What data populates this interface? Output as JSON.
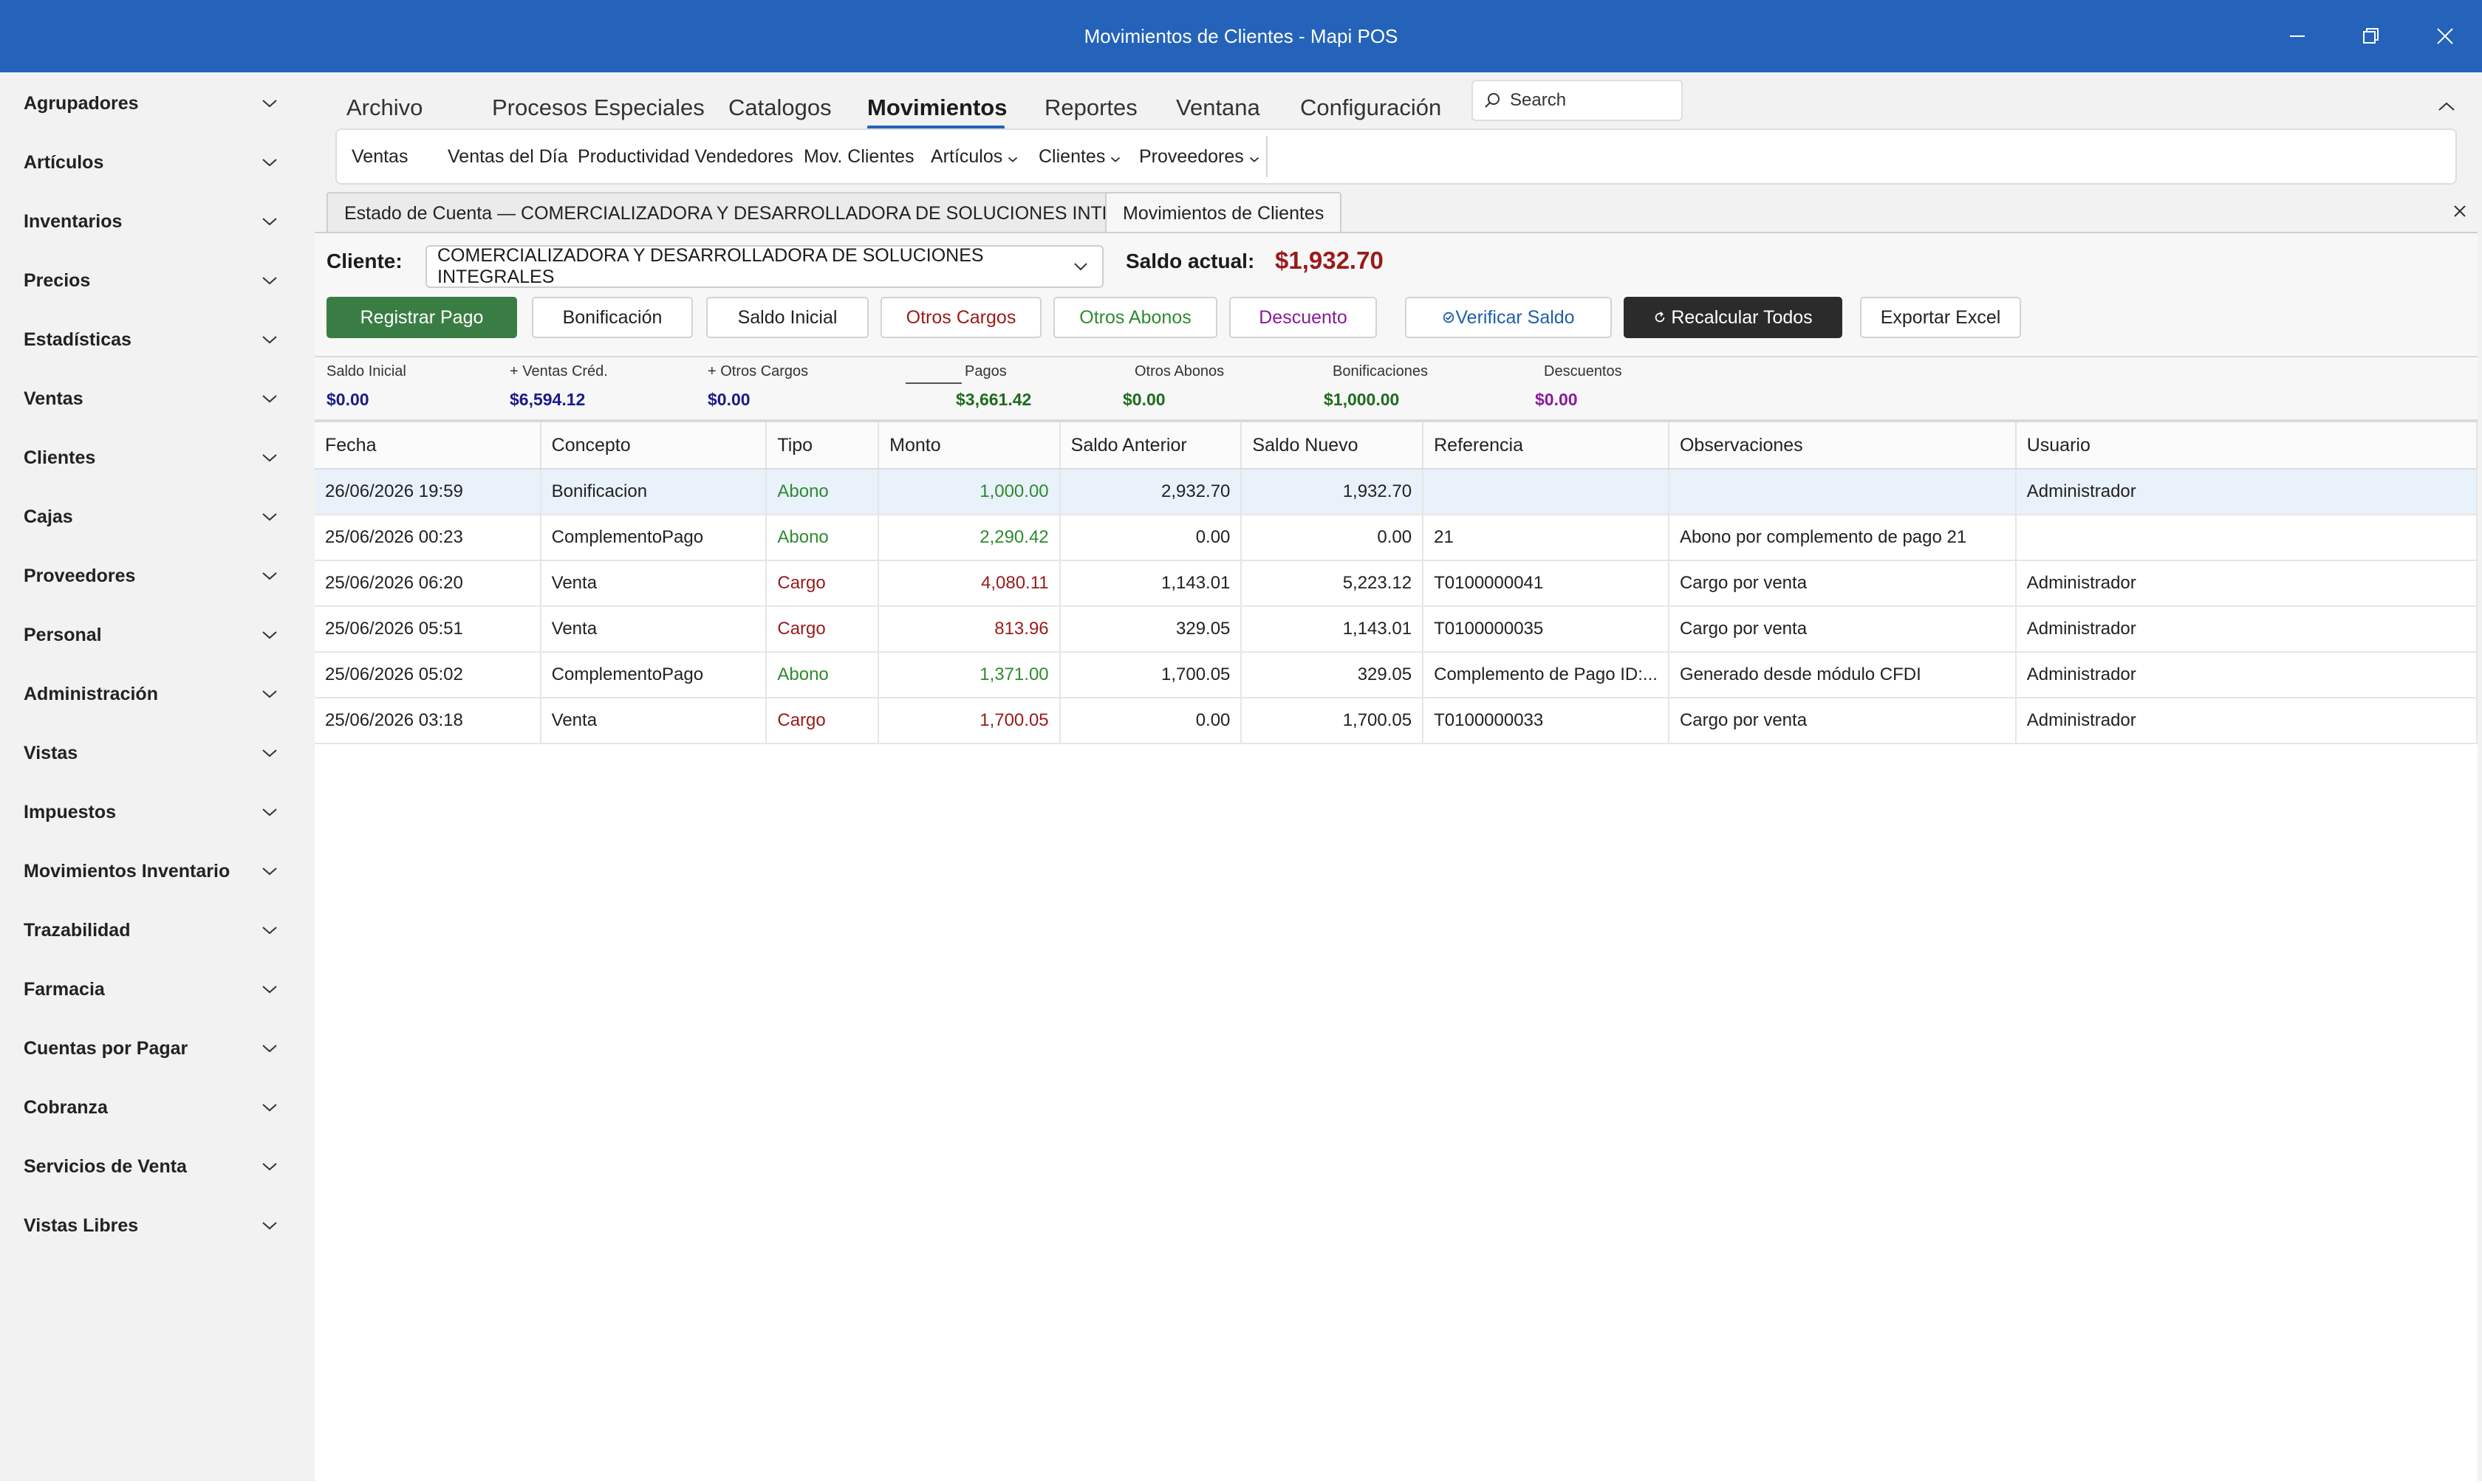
{
  "window": {
    "title": "Movimientos de Clientes - Mapi POS"
  },
  "sidebar": {
    "items": [
      {
        "label": "Agrupadores"
      },
      {
        "label": "Artículos"
      },
      {
        "label": "Inventarios"
      },
      {
        "label": "Precios"
      },
      {
        "label": "Estadísticas"
      },
      {
        "label": "Ventas"
      },
      {
        "label": "Clientes"
      },
      {
        "label": "Cajas"
      },
      {
        "label": "Proveedores"
      },
      {
        "label": "Personal"
      },
      {
        "label": "Administración"
      },
      {
        "label": "Vistas"
      },
      {
        "label": "Impuestos"
      },
      {
        "label": "Movimientos Inventario"
      },
      {
        "label": "Trazabilidad"
      },
      {
        "label": "Farmacia"
      },
      {
        "label": "Cuentas por Pagar"
      },
      {
        "label": "Cobranza"
      },
      {
        "label": "Servicios de Venta"
      },
      {
        "label": "Vistas Libres"
      }
    ]
  },
  "menu": {
    "items": [
      "Archivo",
      "Procesos Especiales",
      "Catalogos",
      "Movimientos",
      "Reportes",
      "Ventana",
      "Configuración"
    ],
    "active": "Movimientos",
    "search_placeholder": "Search"
  },
  "ribbon": {
    "items": [
      "Ventas",
      "Ventas del Día",
      "Productividad Vendedores",
      "Mov. Clientes",
      "Artículos",
      "Clientes",
      "Proveedores"
    ]
  },
  "tabs": [
    {
      "label": "Estado de Cuenta — COMERCIALIZADORA Y DESARROLLADORA DE SOLUCIONES INTEGRALES"
    },
    {
      "label": "Movimientos de Clientes"
    }
  ],
  "toolbar": {
    "cliente_label": "Cliente:",
    "cliente_value": "COMERCIALIZADORA Y DESARROLLADORA DE SOLUCIONES INTEGRALES",
    "saldo_label": "Saldo actual:",
    "saldo_value": "$1,932.70",
    "buttons": {
      "registrar_pago": "Registrar Pago",
      "bonificacion": "Bonificación",
      "saldo_inicial": "Saldo Inicial",
      "otros_cargos": "Otros Cargos",
      "otros_abonos": "Otros Abonos",
      "descuento": "Descuento",
      "verificar_saldo": "Verificar Saldo",
      "recalcular_todos": "Recalcular Todos",
      "exportar_excel": "Exportar Excel"
    }
  },
  "summary": {
    "saldo_inicial": {
      "label": "Saldo Inicial",
      "value": "$0.00"
    },
    "ventas_cred": {
      "label": "+ Ventas Créd.",
      "value": "$6,594.12"
    },
    "otros_cargos": {
      "label": "+ Otros Cargos",
      "value": "$0.00"
    },
    "pagos": {
      "label": "Pagos",
      "value": "$3,661.42"
    },
    "otros_abonos": {
      "label": "Otros Abonos",
      "value": "$0.00"
    },
    "bonificaciones": {
      "label": "Bonificaciones",
      "value": "$1,000.00"
    },
    "descuentos": {
      "label": "Descuentos",
      "value": "$0.00"
    }
  },
  "table": {
    "headers": [
      "Fecha",
      "Concepto",
      "Tipo",
      "Monto",
      "Saldo Anterior",
      "Saldo Nuevo",
      "Referencia",
      "Observaciones",
      "Usuario"
    ],
    "rows": [
      [
        "26/06/2026 19:59",
        "Bonificacion",
        "Abono",
        "1,000.00",
        "2,932.70",
        "1,932.70",
        "",
        "",
        "Administrador"
      ],
      [
        "25/06/2026 00:23",
        "ComplementoPago",
        "Abono",
        "2,290.42",
        "0.00",
        "0.00",
        "21",
        "Abono por complemento de pago 21",
        ""
      ],
      [
        "25/06/2026 06:20",
        "Venta",
        "Cargo",
        "4,080.11",
        "1,143.01",
        "5,223.12",
        "T0100000041",
        "Cargo por venta",
        "Administrador"
      ],
      [
        "25/06/2026 05:51",
        "Venta",
        "Cargo",
        "813.96",
        "329.05",
        "1,143.01",
        "T0100000035",
        "Cargo por venta",
        "Administrador"
      ],
      [
        "25/06/2026 05:02",
        "ComplementoPago",
        "Abono",
        "1,371.00",
        "1,700.05",
        "329.05",
        "Complemento de Pago ID:...",
        "Generado desde módulo CFDI",
        "Administrador"
      ],
      [
        "25/06/2026 03:18",
        "Venta",
        "Cargo",
        "1,700.05",
        "0.00",
        "1,700.05",
        "T0100000033",
        "Cargo por venta",
        "Administrador"
      ]
    ]
  },
  "colors": {
    "titlebar": "#2463b9",
    "accent_green": "#3a7d44",
    "cargo_red": "#9b1a1a",
    "abono_green": "#2e8b2e",
    "summary_blue": "#1a1a8c",
    "descuento_purple": "#8b1a9b",
    "dark_button": "#2b2b2b"
  }
}
